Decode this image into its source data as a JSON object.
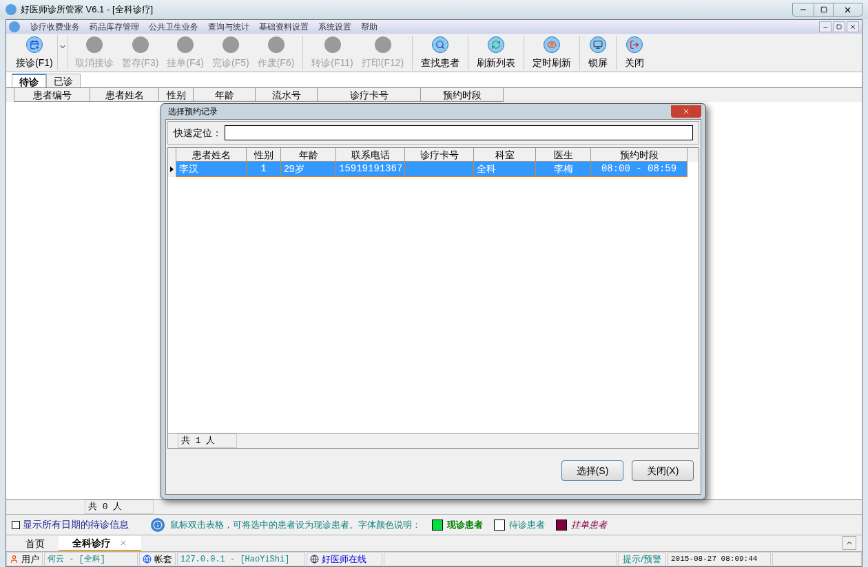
{
  "window": {
    "title": "好医师诊所管家 V6.1 - [全科诊疗]"
  },
  "menu": [
    "诊疗收费业务",
    "药品库存管理",
    "公共卫生业务",
    "查询与统计",
    "基础资料设置",
    "系统设置",
    "帮助"
  ],
  "toolbar": [
    {
      "label": "接诊(F1)",
      "kind": "add",
      "disabled": false
    },
    {
      "label": "取消接诊",
      "kind": "plain",
      "disabled": true
    },
    {
      "label": "暂存(F3)",
      "kind": "plain",
      "disabled": true
    },
    {
      "label": "挂单(F4)",
      "kind": "plain",
      "disabled": true
    },
    {
      "label": "完诊(F5)",
      "kind": "plain",
      "disabled": true
    },
    {
      "label": "作废(F6)",
      "kind": "plain",
      "disabled": true
    },
    {
      "label": "转诊(F11)",
      "kind": "plain",
      "disabled": true
    },
    {
      "label": "打印(F12)",
      "kind": "plain",
      "disabled": true
    },
    {
      "label": "查找患者",
      "kind": "search",
      "disabled": false
    },
    {
      "label": "刷新列表",
      "kind": "refresh",
      "disabled": false
    },
    {
      "label": "定时刷新",
      "kind": "eye",
      "disabled": false
    },
    {
      "label": "锁屏",
      "kind": "monitor",
      "disabled": false
    },
    {
      "label": "关闭",
      "kind": "exit",
      "disabled": false
    }
  ],
  "tabs": [
    {
      "label": "待诊",
      "selected": true
    },
    {
      "label": "已诊",
      "selected": false
    }
  ],
  "table": {
    "columns": [
      "患者编号",
      "患者姓名",
      "性别",
      "年龄",
      "流水号",
      "诊疗卡号",
      "预约时段"
    ],
    "count": "共 0 人"
  },
  "dialog": {
    "title": "选择预约记录",
    "search_label": "快速定位：",
    "columns": [
      "患者姓名",
      "性别",
      "年龄",
      "联系电话",
      "诊疗卡号",
      "科室",
      "医生",
      "预约时段"
    ],
    "rows": [
      {
        "selected": true,
        "cells": [
          "李汉",
          "1",
          "29岁",
          "15919191367",
          "",
          "全科",
          "李梅",
          "08:00 - 08:59"
        ]
      }
    ],
    "count": "共 1 人",
    "buttons": [
      "选择(S)",
      "关闭(X)"
    ]
  },
  "show_all_dates": {
    "label": "显示所有日期的待诊信息",
    "checked": false
  },
  "hint": "鼠标双击表格，可将选中的患者设为现诊患者。字体颜色说明：",
  "legend": [
    {
      "label": "现诊患者",
      "color": "#00e040"
    },
    {
      "label": "待诊患者",
      "color": "#ffffff"
    },
    {
      "label": "挂单患者",
      "color": "#800040"
    }
  ],
  "doc_tabs": [
    {
      "label": "首页",
      "selected": false,
      "closable": false
    },
    {
      "label": "全科诊疗",
      "selected": true,
      "closable": true
    }
  ],
  "status_bar": {
    "user_label": "用户",
    "user": "何云 - [全科]",
    "account_label": "帐套",
    "server": "127.0.0.1 - [HaoYiShi]",
    "online": "好医师在线",
    "alert": "提示/预警",
    "datetime": "2015-08-27 08:09:44"
  }
}
